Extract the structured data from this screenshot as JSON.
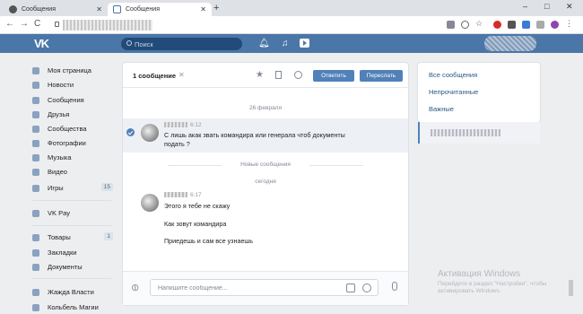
{
  "browser": {
    "tabs": [
      {
        "title": "Сообщения"
      },
      {
        "title": "Сообщения"
      }
    ],
    "new_tab": "+",
    "window_controls": [
      "–",
      "□",
      "✕"
    ],
    "nav": [
      "←",
      "→",
      "C"
    ]
  },
  "header": {
    "logo": "VK",
    "search_placeholder": "Поиск"
  },
  "left_nav": {
    "items": [
      {
        "label": "Моя страница",
        "icon": "home-icon"
      },
      {
        "label": "Новости",
        "icon": "news-icon"
      },
      {
        "label": "Сообщения",
        "icon": "messages-icon"
      },
      {
        "label": "Друзья",
        "icon": "friends-icon"
      },
      {
        "label": "Сообщества",
        "icon": "communities-icon"
      },
      {
        "label": "Фотографии",
        "icon": "photos-icon"
      },
      {
        "label": "Музыка",
        "icon": "music-icon"
      },
      {
        "label": "Видео",
        "icon": "video-icon"
      },
      {
        "label": "Игры",
        "icon": "games-icon",
        "count": "15"
      },
      {
        "label": "VK Pay",
        "icon": "vkpay-icon"
      },
      {
        "label": "Товары",
        "icon": "goods-icon",
        "count": "1"
      },
      {
        "label": "Закладки",
        "icon": "bookmarks-icon"
      },
      {
        "label": "Документы",
        "icon": "documents-icon"
      },
      {
        "label": "Жажда Власти",
        "icon": "game-app-icon"
      },
      {
        "label": "Кольбель Магии",
        "icon": "game-app-icon"
      }
    ]
  },
  "chat": {
    "selected_count": "1 сообщение",
    "clear_icon": "✕",
    "reply_label": "Ответить",
    "forward_label": "Переслать",
    "date_divider": "26 февраля",
    "selected_message": {
      "time": "6:12",
      "text_line1": "С лишь акак звать командира или генерала чтоб документы",
      "text_line2": "подать ?"
    },
    "new_messages_label": "Новые сообщения",
    "today_divider": "сегодня",
    "reply_message": {
      "time": "6:17",
      "lines": [
        "Этого я тебе не скажу",
        "Как зовут командира",
        "Приедешь и сам все узнаешь"
      ]
    },
    "composer_placeholder": "Напишите сообщение..."
  },
  "right_nav": {
    "all": "Все сообщения",
    "unread": "Непрочитанные",
    "important": "Важные"
  },
  "watermark": {
    "title": "Активация Windows",
    "line1": "Перейдите в раздел \"Настройки\", чтобы",
    "line2": "активировать Windows."
  },
  "colors": {
    "brand": "#4a76a8",
    "button": "#5181b8",
    "background": "#edeef0"
  }
}
